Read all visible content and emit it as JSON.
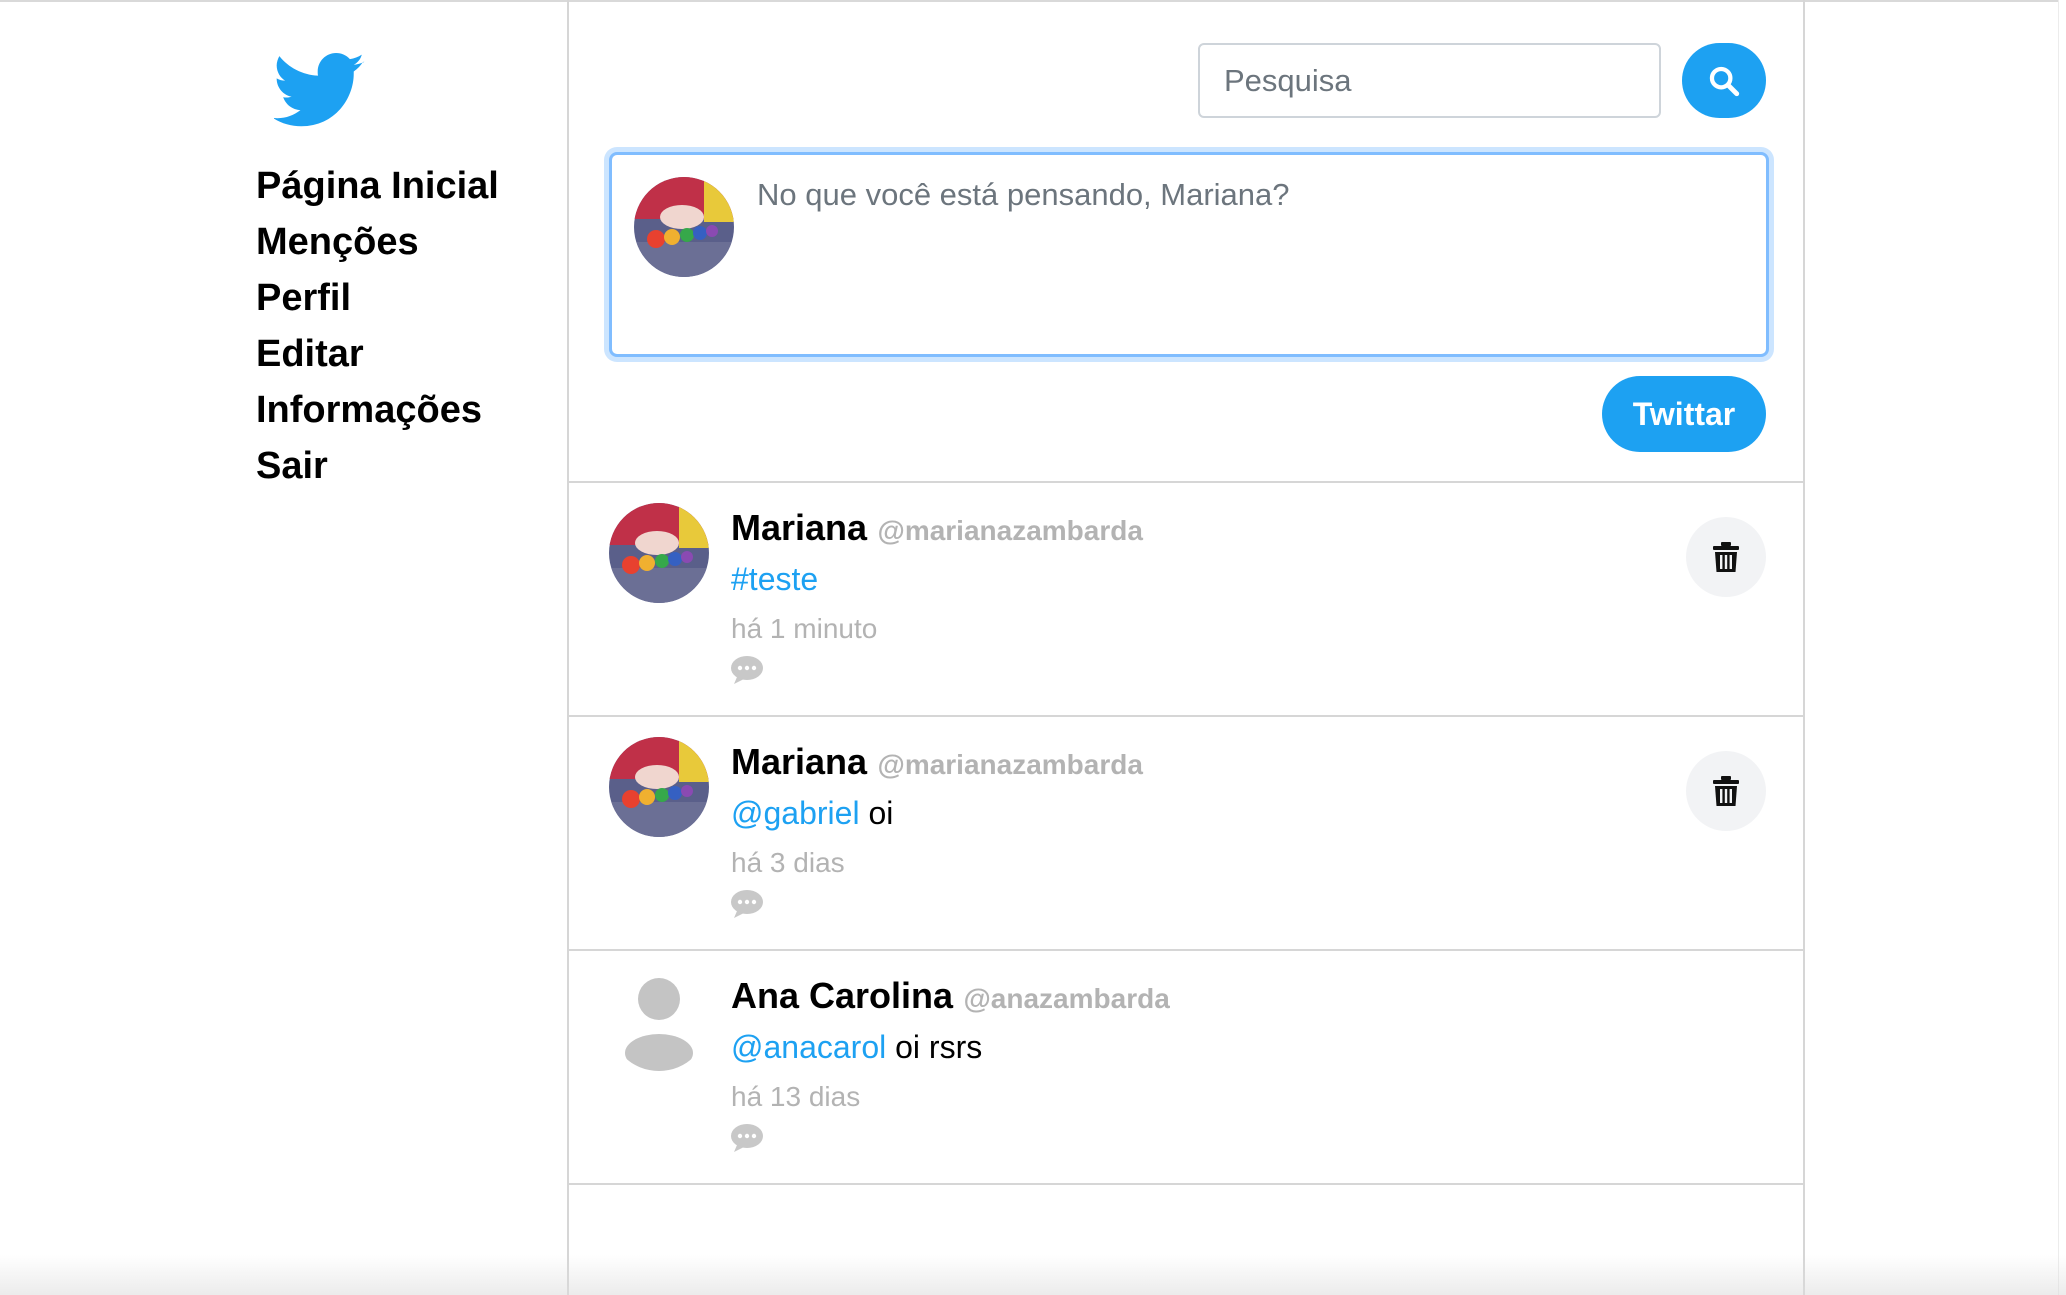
{
  "sidebar": {
    "logo_icon": "twitter-bird-icon",
    "items": [
      {
        "label": "Página Inicial"
      },
      {
        "label": "Menções"
      },
      {
        "label": "Perfil"
      },
      {
        "label": "Editar"
      },
      {
        "label": "Informações"
      },
      {
        "label": "Sair"
      }
    ]
  },
  "search": {
    "placeholder": "Pesquisa",
    "button_icon": "search-icon"
  },
  "composer": {
    "placeholder": "No que você está pensando, Mariana?",
    "submit_label": "Twittar"
  },
  "tweets": [
    {
      "name": "Mariana",
      "handle": "@marianazambarda",
      "mention": "#teste",
      "text": "",
      "time": "há 1 minuto",
      "deletable": true
    },
    {
      "name": "Mariana",
      "handle": "@marianazambarda",
      "mention": "@gabriel",
      "text": " oi",
      "time": "há 3 dias",
      "deletable": true
    },
    {
      "name": "Ana Carolina",
      "handle": "@anazambarda",
      "mention": "@anacarol",
      "text": " oi rsrs",
      "time": "há 13 dias",
      "deletable": false
    }
  ],
  "colors": {
    "brand": "#1da1f2",
    "handle": "#b3b3b3",
    "divider": "#d6d6d6"
  }
}
